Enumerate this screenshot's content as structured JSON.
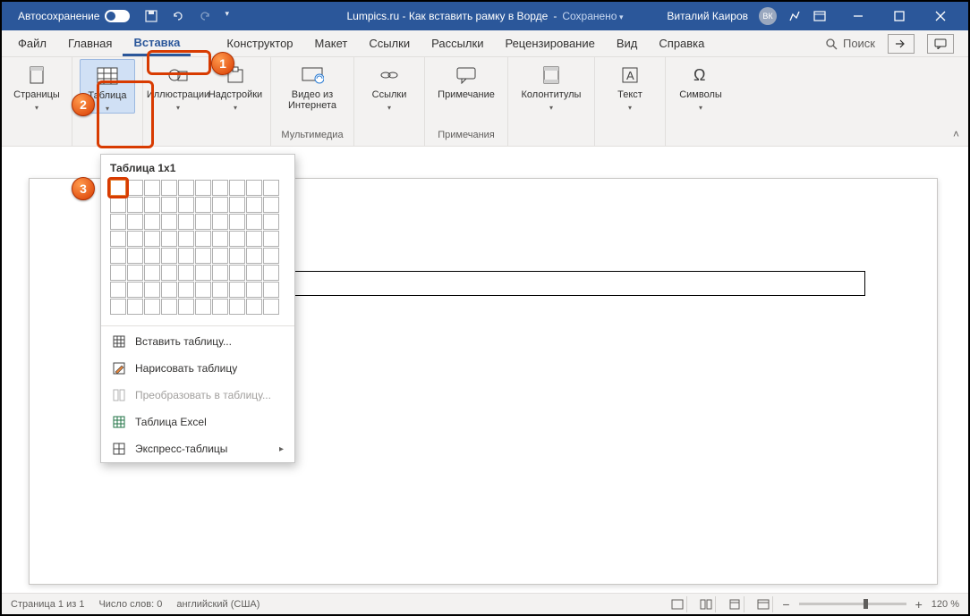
{
  "titlebar": {
    "autosave": "Автосохранение",
    "doc_title": "Lumpics.ru - Как вставить рамку в Ворде",
    "saved_status": "Сохранено",
    "user_name": "Виталий Каиров",
    "user_initials": "ВК"
  },
  "tabs": {
    "file": "Файл",
    "home": "Главная",
    "insert": "Вставка",
    "design": "Конструктор",
    "layout": "Макет",
    "references": "Ссылки",
    "mailings": "Рассылки",
    "review": "Рецензирование",
    "view": "Вид",
    "help": "Справка",
    "search": "Поиск"
  },
  "ribbon": {
    "pages": "Страницы",
    "table": "Таблица",
    "illustrations": "Иллюстрации",
    "addins": "Надстройки",
    "video": "Видео из Интернета",
    "media_group": "Мультимедиа",
    "links": "Ссылки",
    "comment": "Примечание",
    "comments_group": "Примечания",
    "headerfooter": "Колонтитулы",
    "text": "Текст",
    "symbols": "Символы"
  },
  "table_dropdown": {
    "title": "Таблица 1x1",
    "insert_table": "Вставить таблицу...",
    "draw_table": "Нарисовать таблицу",
    "convert_text": "Преобразовать в таблицу...",
    "excel_table": "Таблица Excel",
    "quick_tables": "Экспресс-таблицы"
  },
  "statusbar": {
    "page": "Страница 1 из 1",
    "words": "Число слов: 0",
    "language": "английский (США)",
    "zoom": "120 %"
  },
  "callouts": {
    "c1": "1",
    "c2": "2",
    "c3": "3"
  }
}
